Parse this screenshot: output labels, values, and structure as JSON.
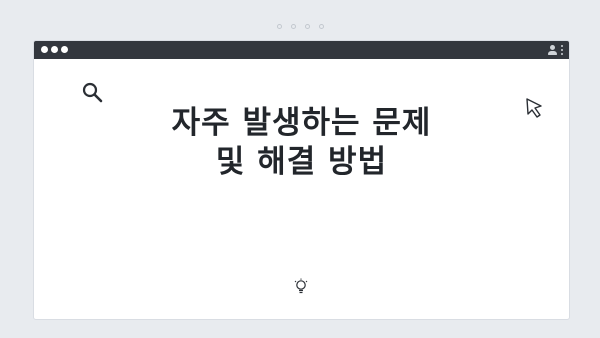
{
  "article": {
    "headline": "자주 발생하는 문제 및 해결 방법"
  },
  "icons": {
    "search": "search-icon",
    "cursor": "cursor-pointer-icon",
    "idea": "lightbulb-icon",
    "user": "user-icon",
    "menu": "more-vertical-icon"
  },
  "colors": {
    "background": "#e8ebef",
    "titlebar": "#33373e",
    "window": "#ffffff",
    "text": "#22262b"
  }
}
